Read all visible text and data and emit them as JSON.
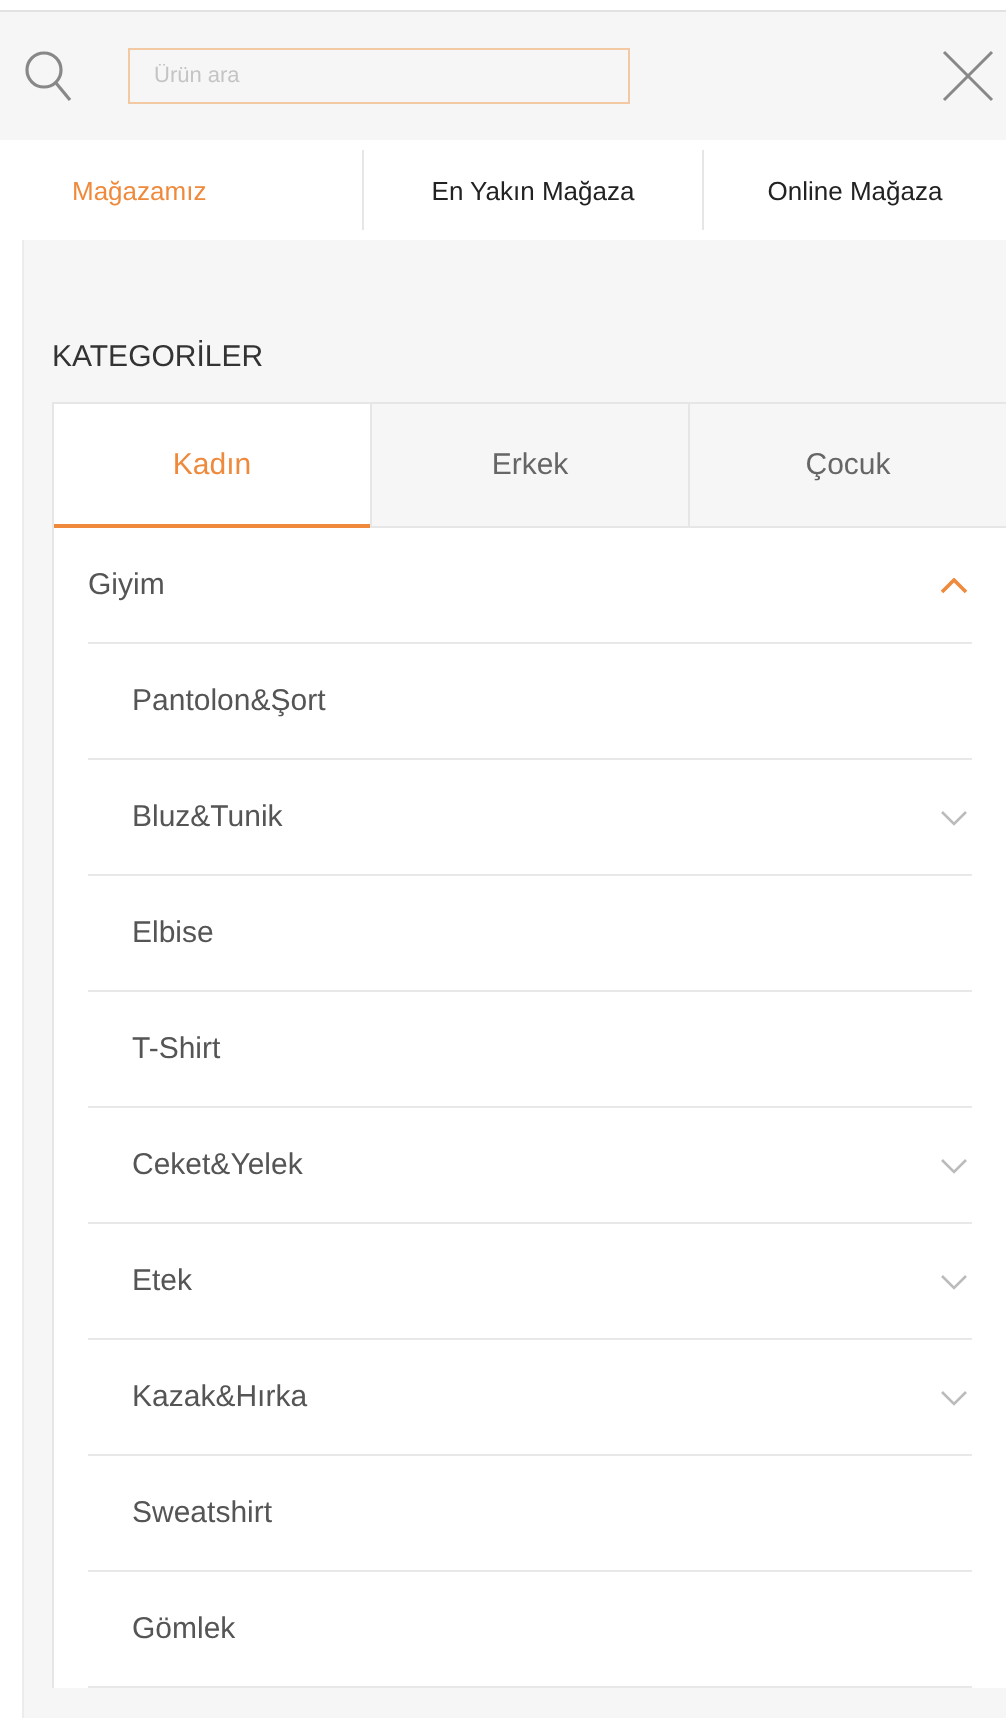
{
  "search": {
    "placeholder": "Ürün ara"
  },
  "store_tabs": [
    {
      "label": "Mağazamız",
      "selected": true
    },
    {
      "label": "En Yakın Mağaza",
      "selected": false
    },
    {
      "label": "Online Mağaza",
      "selected": false
    }
  ],
  "categories": {
    "title": "KATEGORİLER",
    "tabs": [
      {
        "label": "Kadın",
        "selected": true
      },
      {
        "label": "Erkek",
        "selected": false
      },
      {
        "label": "Çocuk",
        "selected": false
      }
    ],
    "items": [
      {
        "label": "Giyim",
        "expanded": true,
        "children": [
          {
            "label": "Pantolon&Şort"
          },
          {
            "label": "Bluz&Tunik",
            "expanded": false
          },
          {
            "label": "Elbise"
          },
          {
            "label": "T-Shirt"
          },
          {
            "label": "Ceket&Yelek",
            "expanded": false
          },
          {
            "label": "Etek",
            "expanded": false
          },
          {
            "label": "Kazak&Hırka",
            "expanded": false
          },
          {
            "label": "Sweatshirt"
          },
          {
            "label": "Gömlek"
          }
        ]
      }
    ]
  }
}
